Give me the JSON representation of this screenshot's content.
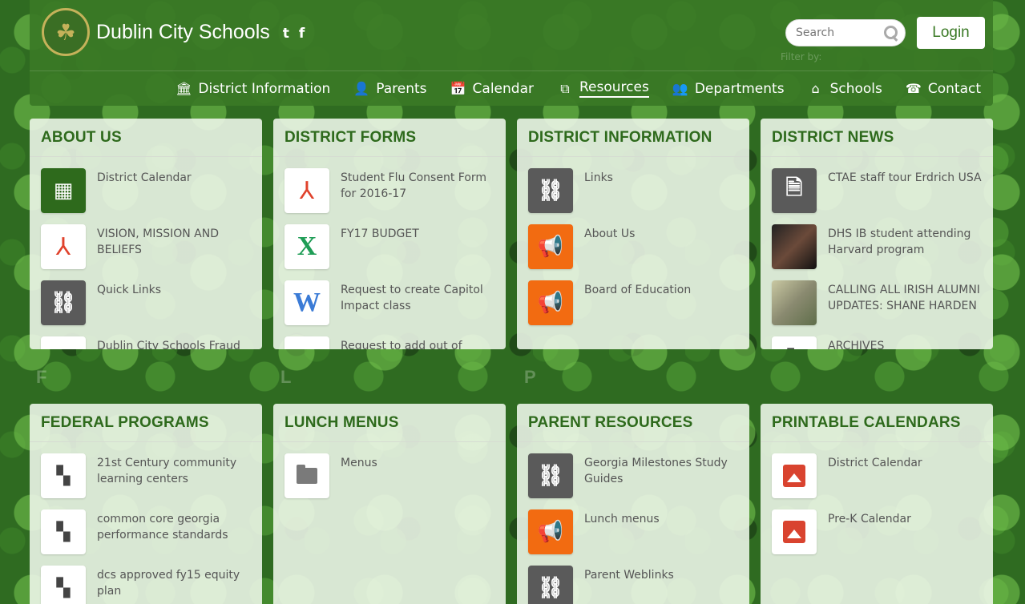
{
  "header": {
    "school_name": "Dublin City Schools",
    "social": {
      "twitter": "t",
      "facebook": "f"
    },
    "search_placeholder": "Search",
    "login_label": "Login",
    "filter_ghost": "Filter by:"
  },
  "nav": [
    {
      "label": "District Information",
      "icon": "bank-icon",
      "glyph": "🏛"
    },
    {
      "label": "Parents",
      "icon": "person-icon",
      "glyph": "👤"
    },
    {
      "label": "Calendar",
      "icon": "calendar-icon",
      "glyph": "📅"
    },
    {
      "label": "Resources",
      "icon": "sitemap-icon",
      "glyph": "⧉"
    },
    {
      "label": "Departments",
      "icon": "group-icon",
      "glyph": "👥"
    },
    {
      "label": "Schools",
      "icon": "home-icon",
      "glyph": "⌂"
    },
    {
      "label": "Contact",
      "icon": "phone-icon",
      "glyph": "☎"
    }
  ],
  "cards": {
    "about_us": {
      "title": "ABOUT US",
      "items": [
        {
          "text": "District Calendar"
        },
        {
          "text": "VISION, MISSION AND BELIEFS"
        },
        {
          "text": "Quick Links"
        },
        {
          "text": "Dublin City Schools Fraud"
        }
      ]
    },
    "district_forms": {
      "title": "DISTRICT FORMS",
      "items": [
        {
          "text": "Student Flu Consent Form for 2016-17"
        },
        {
          "text": "FY17 BUDGET"
        },
        {
          "text": "Request to create Capitol Impact class"
        },
        {
          "text": "Request to add out of district"
        }
      ]
    },
    "district_information": {
      "title": "DISTRICT INFORMATION",
      "items": [
        {
          "text": "Links"
        },
        {
          "text": "About Us"
        },
        {
          "text": "Board of Education"
        }
      ]
    },
    "district_news": {
      "title": "DISTRICT NEWS",
      "items": [
        {
          "text": "CTAE staff tour Erdrich USA"
        },
        {
          "text": "DHS IB student attending Harvard program"
        },
        {
          "text": "CALLING ALL IRISH ALUMNI UPDATES: SHANE HARDEN"
        },
        {
          "text": "ARCHIVES"
        }
      ]
    },
    "federal_programs": {
      "title": "FEDERAL PROGRAMS",
      "items": [
        {
          "text": "21st Century community learning centers"
        },
        {
          "text": "common core georgia performance standards"
        },
        {
          "text": "dcs approved fy15 equity plan"
        }
      ]
    },
    "lunch_menus": {
      "title": "LUNCH MENUS",
      "items": [
        {
          "text": "Menus"
        }
      ]
    },
    "parent_resources": {
      "title": "PARENT RESOURCES",
      "items": [
        {
          "text": "Georgia Milestones Study Guides"
        },
        {
          "text": "Lunch menus"
        },
        {
          "text": "Parent Weblinks"
        }
      ]
    },
    "printable_calendars": {
      "title": "PRINTABLE CALENDARS",
      "items": [
        {
          "text": "District Calendar"
        },
        {
          "text": "Pre-K Calendar"
        }
      ]
    }
  },
  "ghost_letters": [
    "F",
    "L",
    "P"
  ],
  "colors": {
    "brand_green": "#2e6a1c",
    "header_green": "#3a7a26",
    "orange": "#f26b11",
    "gray_tile": "#5a5a5a"
  }
}
